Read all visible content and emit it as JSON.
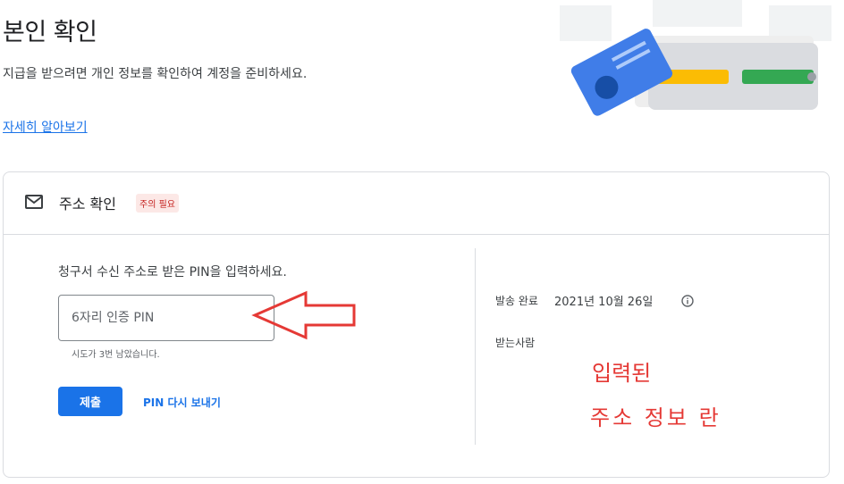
{
  "page": {
    "title": "본인 확인",
    "description": "지급을 받으려면 개인 정보를 확인하여 계정을 준비하세요.",
    "learn_more": "자세히 알아보기"
  },
  "card": {
    "title": "주소 확인",
    "badge": "주의 필요",
    "instruction": "청구서 수신 주소로 받은 PIN을 입력하세요.",
    "pin_placeholder": "6자리 인증 PIN",
    "attempts_text": "시도가 3번 남았습니다.",
    "submit_label": "제출",
    "resend_label": "PIN 다시 보내기",
    "sent_label": "발송 완료",
    "sent_date": "2021년 10월 26일",
    "recipient_label": "받는사람"
  },
  "annotation": {
    "line1": "입력된",
    "line2": "주소 정보 란",
    "color": "#e53935"
  },
  "icons": {
    "header": "mail-icon",
    "info": "info-icon",
    "illustration": "id-card-wallet-illustration"
  },
  "colors": {
    "accent": "#1a73e8",
    "badge_bg": "#fce8e6",
    "badge_text": "#c5221f"
  }
}
